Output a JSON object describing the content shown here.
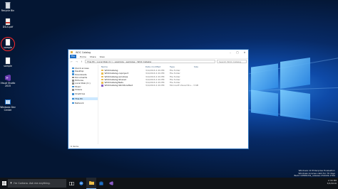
{
  "desktop": {
    "icons": [
      {
        "label": "Recycle Bin",
        "icon": "recycle-bin-icon"
      },
      {
        "label": "DSLS.pdf",
        "icon": "pdf-file-icon"
      },
      {
        "label": "sample",
        "icon": "file-icon"
      },
      {
        "label": "sample",
        "icon": "file-icon"
      },
      {
        "label": "Visual Studio 2015",
        "icon": "visual-studio-icon"
      },
      {
        "label": "Windows Dev Center",
        "icon": "dev-center-icon"
      }
    ],
    "watermark_line1": "Windows 10 Enterprise Evaluation",
    "watermark_line2": "Windows License valid for 79 days",
    "watermark_line3": "Build 10586.th2_release.151029-1700"
  },
  "explorer": {
    "title": "WOC Catalog",
    "ribbon_tabs": [
      "File",
      "Home",
      "Share",
      "View"
    ],
    "address": "This PC  ›  Local Disk (C:)  ›  example  ›  samples  ›  WOC Catalog",
    "search_placeholder": "Search WOC Catalog",
    "nav_items": [
      {
        "label": "Quick access",
        "icon": "star-icon",
        "color": "#3d8fd6"
      },
      {
        "label": "Desktop",
        "icon": "desktop-icon",
        "color": "#3d8fd6"
      },
      {
        "label": "Downloads",
        "icon": "download-icon",
        "color": "#3d8fd6"
      },
      {
        "label": "Documents",
        "icon": "document-icon",
        "color": "#8c8c8c"
      },
      {
        "label": "Pictures",
        "icon": "pictures-icon",
        "color": "#8c8c8c"
      },
      {
        "label": "Local Disk (C:)",
        "icon": "drive-icon",
        "color": "#8c8c8c"
      },
      {
        "label": "Music",
        "icon": "music-icon",
        "color": "#3d8fd6"
      },
      {
        "label": "Videos",
        "icon": "video-icon",
        "color": "#8c8c8c"
      },
      {
        "label": "OneDrive",
        "icon": "cloud-icon",
        "color": "#3d8fd6"
      },
      {
        "label": "This PC",
        "icon": "computer-icon",
        "color": "#3d8fd6"
      },
      {
        "label": "Network",
        "icon": "network-icon",
        "color": "#3d8fd6"
      }
    ],
    "columns": [
      "Name",
      "Date modified",
      "Type",
      "Size"
    ],
    "files": [
      {
        "name": "WOCCatalog",
        "date": "3/4/2016 2:29 PM",
        "type": "File folder",
        "size": "",
        "kind": "folder"
      },
      {
        "name": "WOCCatalog.csproject",
        "date": "3/4/2016 2:29 PM",
        "type": "File folder",
        "size": "",
        "kind": "folder"
      },
      {
        "name": "WOCCatalog.windows",
        "date": "3/4/2016 2:29 PM",
        "type": "File folder",
        "size": "",
        "kind": "folder"
      },
      {
        "name": "WOCCatalog.Shared",
        "date": "3/4/2016 2:29 PM",
        "type": "File folder",
        "size": "",
        "kind": "folder"
      },
      {
        "name": "WOCCatalogTests",
        "date": "3/4/2016 2:29 PM",
        "type": "File folder",
        "size": "",
        "kind": "folder"
      },
      {
        "name": "WOCCatalog.WinStoreTest",
        "date": "3/4/2016 2:29 PM",
        "type": "Microsoft Visual Stu...",
        "size": "3 KB",
        "kind": "solution"
      }
    ],
    "status": "6 items"
  },
  "taskbar": {
    "search_placeholder": "I'm Cortana. Ask me anything.",
    "apps": [
      "task-view-icon",
      "edge-icon",
      "file-explorer-icon",
      "store-icon",
      "visual-studio-icon"
    ],
    "time": "2:30 PM",
    "date": "3/4/2016"
  }
}
